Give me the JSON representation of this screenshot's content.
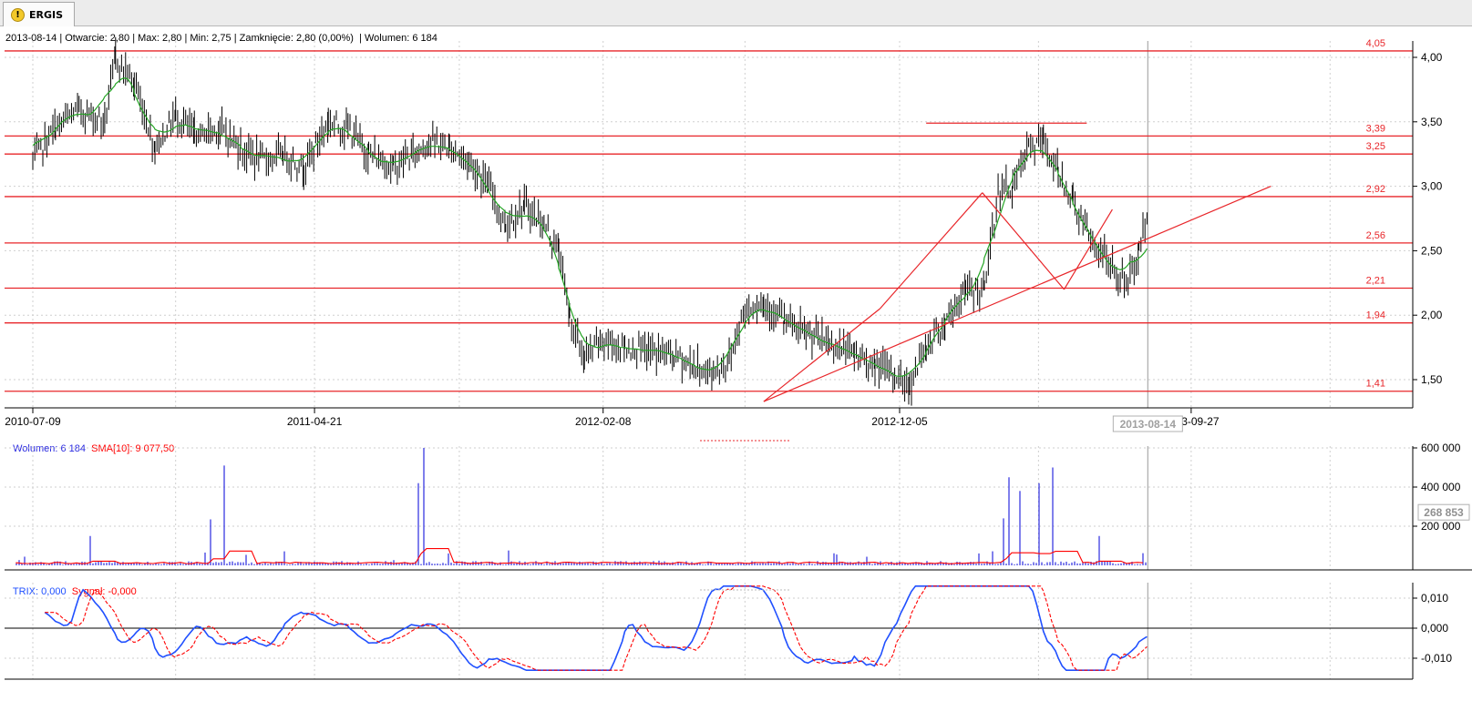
{
  "tab": {
    "label": "ERGIS",
    "icon": "warning-icon"
  },
  "info_line": "2013-08-14 | Otwarcie: 2,80 | Max: 2,80 | Min: 2,75 | Zamknięcie: 2,80 (0,00%)  | Wolumen: 6 184",
  "colors": {
    "grid": "#cfcfcf",
    "hline": "#e8262a",
    "price": "#000000",
    "sma": "#23a423",
    "volume": "#2a2ae0",
    "trix": "#2050ff",
    "signal": "#ff0000"
  },
  "chart_data": [
    {
      "type": "line",
      "name": "price",
      "x_ticks": [
        "2010-07-09",
        "2011-04-21",
        "2012-02-08",
        "2012-12-05",
        "2013-08-14",
        "2013-09-27"
      ],
      "cursor_date": "2013-08-14",
      "ylim": [
        1.35,
        4.1
      ],
      "y_ticks": [
        "1,50",
        "2,00",
        "2,50",
        "3,00",
        "3,50",
        "4,00"
      ],
      "y_tick_values": [
        1.5,
        2.0,
        2.5,
        3.0,
        3.5,
        4.0
      ],
      "horizontal_levels": [
        {
          "value": 4.05,
          "label": "4,05"
        },
        {
          "value": 3.39,
          "label": "3,39"
        },
        {
          "value": 3.25,
          "label": "3,25"
        },
        {
          "value": 2.92,
          "label": "2,92"
        },
        {
          "value": 2.56,
          "label": "2,56"
        },
        {
          "value": 2.21,
          "label": "2,21"
        },
        {
          "value": 1.94,
          "label": "1,94"
        },
        {
          "value": 1.41,
          "label": "1,41"
        }
      ],
      "trend_lines": [
        {
          "from": [
            "2012-07-20",
            1.33
          ],
          "to": [
            "2013-12-17",
            3.0
          ]
        },
        {
          "from": [
            "2012-07-20",
            1.33
          ],
          "to": [
            "2012-11-15",
            2.05
          ]
        },
        {
          "from": [
            "2012-11-15",
            2.05
          ],
          "to": [
            "2013-02-27",
            2.95
          ]
        },
        {
          "from": [
            "2013-02-27",
            2.95
          ],
          "to": [
            "2013-05-21",
            2.2
          ]
        },
        {
          "from": [
            "2013-05-21",
            2.2
          ],
          "to": [
            "2013-07-09",
            2.82
          ]
        },
        {
          "from": [
            "2013-01-01",
            3.49
          ],
          "to": [
            "2013-06-13",
            3.49
          ]
        }
      ],
      "close_series": [
        [
          "2010-07-09",
          3.2
        ],
        [
          "2010-08-01",
          3.45
        ],
        [
          "2010-08-25",
          3.6
        ],
        [
          "2010-09-20",
          3.5
        ],
        [
          "2010-10-01",
          4.0
        ],
        [
          "2010-10-20",
          3.8
        ],
        [
          "2010-11-10",
          3.3
        ],
        [
          "2010-12-01",
          3.55
        ],
        [
          "2010-12-20",
          3.4
        ],
        [
          "2011-01-15",
          3.45
        ],
        [
          "2011-02-05",
          3.3
        ],
        [
          "2011-02-25",
          3.2
        ],
        [
          "2011-03-20",
          3.25
        ],
        [
          "2011-04-10",
          3.15
        ],
        [
          "2011-05-05",
          3.5
        ],
        [
          "2011-05-25",
          3.45
        ],
        [
          "2011-06-15",
          3.25
        ],
        [
          "2011-07-10",
          3.15
        ],
        [
          "2011-07-30",
          3.25
        ],
        [
          "2011-08-15",
          3.35
        ],
        [
          "2011-09-05",
          3.3
        ],
        [
          "2011-09-25",
          3.2
        ],
        [
          "2011-10-15",
          3.0
        ],
        [
          "2011-11-01",
          2.7
        ],
        [
          "2011-11-20",
          2.85
        ],
        [
          "2011-12-10",
          2.7
        ],
        [
          "2011-12-25",
          2.5
        ],
        [
          "2012-01-05",
          2.0
        ],
        [
          "2012-01-20",
          1.65
        ],
        [
          "2012-02-05",
          1.8
        ],
        [
          "2012-03-01",
          1.75
        ],
        [
          "2012-03-25",
          1.72
        ],
        [
          "2012-04-20",
          1.7
        ],
        [
          "2012-05-10",
          1.6
        ],
        [
          "2012-05-30",
          1.55
        ],
        [
          "2012-06-15",
          1.65
        ],
        [
          "2012-07-01",
          2.05
        ],
        [
          "2012-07-20",
          2.1
        ],
        [
          "2012-08-10",
          1.95
        ],
        [
          "2012-09-01",
          1.85
        ],
        [
          "2012-09-25",
          1.78
        ],
        [
          "2012-10-20",
          1.7
        ],
        [
          "2012-11-10",
          1.6
        ],
        [
          "2012-11-30",
          1.55
        ],
        [
          "2012-12-15",
          1.45
        ],
        [
          "2013-01-01",
          1.75
        ],
        [
          "2013-01-20",
          1.95
        ],
        [
          "2013-02-10",
          2.2
        ],
        [
          "2013-03-01",
          2.2
        ],
        [
          "2013-03-15",
          2.95
        ],
        [
          "2013-03-30",
          3.0
        ],
        [
          "2013-04-15",
          3.3
        ],
        [
          "2013-04-30",
          3.35
        ],
        [
          "2013-05-15",
          3.1
        ],
        [
          "2013-05-30",
          2.9
        ],
        [
          "2013-06-15",
          2.6
        ],
        [
          "2013-07-01",
          2.45
        ],
        [
          "2013-07-15",
          2.3
        ],
        [
          "2013-07-25",
          2.25
        ],
        [
          "2013-08-05",
          2.5
        ],
        [
          "2013-08-14",
          2.8
        ]
      ]
    },
    {
      "type": "bar",
      "name": "Wolumen",
      "legend": [
        {
          "label": "Wolumen: 6 184",
          "color": "#2a2ae0"
        },
        {
          "label": "SMA[10]: 9 077,50",
          "color": "#ff0000"
        }
      ],
      "ylim": [
        0,
        600000
      ],
      "y_ticks": [
        "200 000",
        "400 000",
        "600 000"
      ],
      "y_tick_values": [
        200000,
        400000,
        600000
      ],
      "current_value_label": "268 853",
      "current_value": 268853,
      "spikes": [
        [
          "2010-09-05",
          150000
        ],
        [
          "2011-01-20",
          510000
        ],
        [
          "2011-01-05",
          235000
        ],
        [
          "2011-08-05",
          420000
        ],
        [
          "2011-08-10",
          600000
        ],
        [
          "2013-03-25",
          450000
        ],
        [
          "2013-04-25",
          420000
        ],
        [
          "2013-05-10",
          500000
        ],
        [
          "2013-03-20",
          240000
        ],
        [
          "2013-04-05",
          380000
        ],
        [
          "2013-06-25",
          150000
        ]
      ]
    },
    {
      "type": "line",
      "name": "TRIX",
      "legend": [
        {
          "label": "TRIX: 0,000",
          "color": "#2050ff"
        },
        {
          "label": "Sygnał: -0,000",
          "color": "#ff0000"
        }
      ],
      "ylim": [
        -0.015,
        0.015
      ],
      "y_ticks": [
        "-0,010",
        "0,000",
        "0,010"
      ],
      "y_tick_values": [
        -0.01,
        0.0,
        0.01
      ]
    }
  ]
}
